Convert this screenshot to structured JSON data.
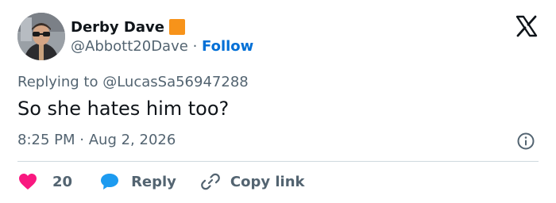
{
  "user": {
    "display_name": "Derby Dave",
    "handle": "@Abbott20Dave",
    "separator": "·",
    "follow_label": "Follow",
    "flag_color": "#f7931a"
  },
  "brand": {
    "logo_icon": "x-logo-icon"
  },
  "tweet": {
    "replying_prefix": "Replying to",
    "replying_to": "@LucasSa56947288",
    "text": "So she hates him too?",
    "time": "8:25 PM",
    "date_separator": "·",
    "date": "Aug 2, 2026"
  },
  "actions": {
    "like_count": "20",
    "reply_label": "Reply",
    "copy_link_label": "Copy link"
  },
  "colors": {
    "like": "#f91880",
    "reply": "#1d9bf0",
    "follow": "#006fd6",
    "secondary_text": "#536471"
  }
}
